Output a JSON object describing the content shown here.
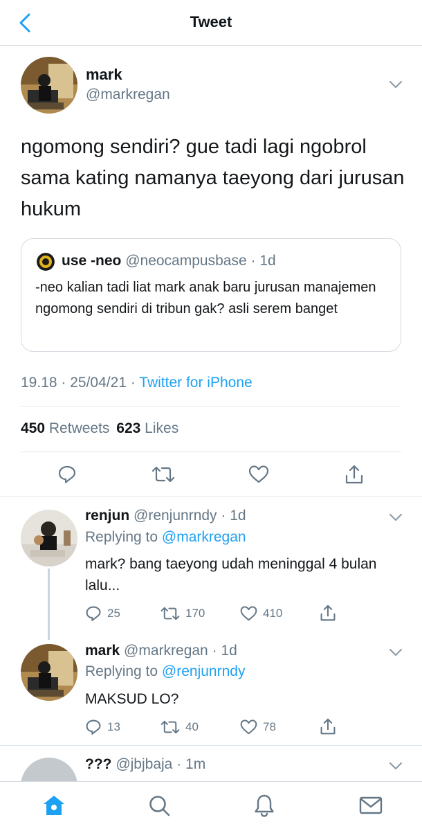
{
  "header": {
    "title": "Tweet"
  },
  "tweet": {
    "name": "mark",
    "handle": "@markregan",
    "text": "ngomong sendiri? gue tadi lagi ngobrol sama kating namanya taeyong dari jurusan hukum",
    "quote": {
      "name": "use -neo",
      "handle": "@neocampusbase",
      "sep": " · ",
      "time": "1d",
      "text": "-neo kalian tadi liat mark anak baru jurusan manajemen ngomong sendiri di tribun gak? asli serem banget"
    },
    "meta": {
      "time": "19.18",
      "sep1": " · ",
      "date": "25/04/21",
      "sep2": " · ",
      "source": "Twitter for iPhone"
    },
    "stats": {
      "retweets": "450",
      "retweets_label": "Retweets",
      "likes": "623",
      "likes_label": "Likes"
    }
  },
  "replies": [
    {
      "name": "renjun",
      "handle": "@renjunrndy",
      "sep": " · ",
      "time": "1d",
      "replying_label": "Replying to",
      "replying_to": "@markregan",
      "text": "mark? bang taeyong udah meninggal 4 bulan lalu...",
      "replies": "25",
      "retweets": "170",
      "likes": "410"
    },
    {
      "name": "mark",
      "handle": "@markregan",
      "sep": " · ",
      "time": "1d",
      "replying_label": "Replying to",
      "replying_to": "@renjunrndy",
      "text": "MAKSUD LO?",
      "replies": "13",
      "retweets": "40",
      "likes": "78"
    },
    {
      "name": "???",
      "handle": "@jbjbaja",
      "sep": " · ",
      "time": "1m"
    }
  ],
  "colors": {
    "accent": "#1da1f2",
    "muted": "#657786",
    "border": "#e1e8ed"
  }
}
